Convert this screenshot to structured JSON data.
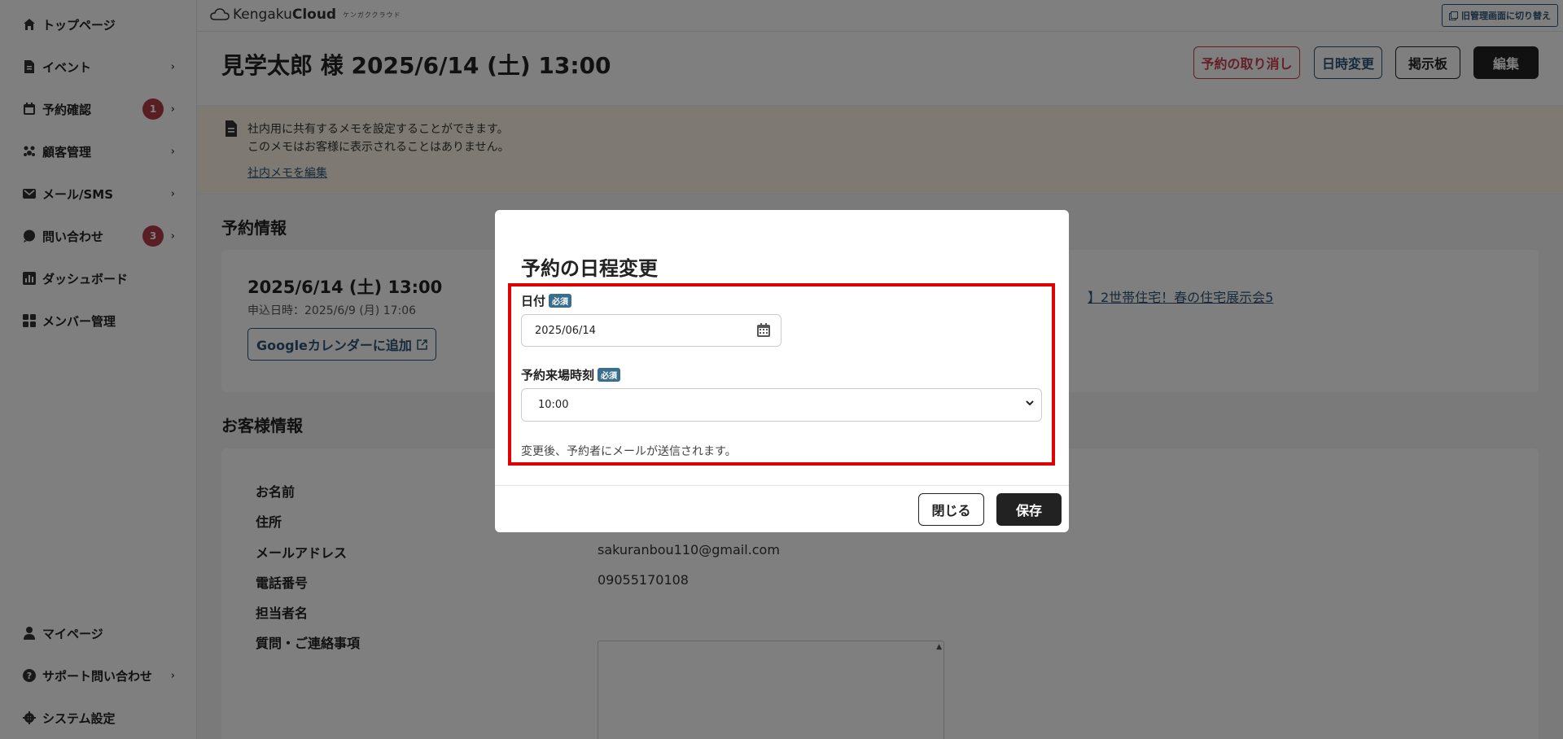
{
  "sidebar": {
    "top_items": [
      {
        "label": "トップページ",
        "icon": "home-icon",
        "chevron": ""
      },
      {
        "label": "イベント",
        "icon": "document-icon",
        "chevron": "›"
      },
      {
        "label": "予約確認",
        "icon": "calendar-icon",
        "chevron": "›",
        "badge": "1"
      },
      {
        "label": "顧客管理",
        "icon": "users-icon",
        "chevron": "›"
      },
      {
        "label": "メール/SMS",
        "icon": "mail-icon",
        "chevron": "›"
      },
      {
        "label": "問い合わせ",
        "icon": "chat-icon",
        "chevron": "›",
        "badge": "3"
      },
      {
        "label": "ダッシュボード",
        "icon": "chart-icon",
        "chevron": ""
      },
      {
        "label": "メンバー管理",
        "icon": "grid-icon",
        "chevron": ""
      }
    ],
    "bottom_items": [
      {
        "label": "マイページ",
        "icon": "user-icon",
        "chevron": ""
      },
      {
        "label": "サポート問い合わせ",
        "icon": "help-icon",
        "chevron": "›"
      },
      {
        "label": "システム設定",
        "icon": "gear-icon",
        "chevron": ""
      }
    ]
  },
  "topbar": {
    "logo_main": "Kengaku",
    "logo_bold": "Cloud",
    "logo_sub": "ケンガククラウド",
    "switch_label": "旧管理画面に切り替え"
  },
  "header": {
    "title": "見学太郎 様 2025/6/14 (土) 13:00",
    "cancel_label": "予約の取り消し",
    "reschedule_label": "日時変更",
    "board_label": "掲示板",
    "edit_label": "編集"
  },
  "memo": {
    "line1": "社内用に共有するメモを設定することができます。",
    "line2": "このメモはお客様に表示されることはありません。",
    "link": "社内メモを編集"
  },
  "reservation": {
    "section_title": "予約情報",
    "date": "2025/6/14 (土) 13:00",
    "applied": "申込日時：2025/6/9 (月) 17:06",
    "gcal_label": "Googleカレンダーに追加",
    "event_link": "】2世帯住宅！春の住宅展示会5"
  },
  "customer": {
    "section_title": "お客様情報",
    "rows": [
      {
        "label": "お名前",
        "value": ""
      },
      {
        "label": "住所",
        "value": ""
      },
      {
        "label": "メールアドレス",
        "value": "sakuranbou110@gmail.com"
      },
      {
        "label": "電話番号",
        "value": "09055170108"
      },
      {
        "label": "担当者名",
        "value": ""
      },
      {
        "label": "質問・ご連絡事項",
        "value": ""
      }
    ]
  },
  "modal": {
    "title": "予約の日程変更",
    "date_label": "日付",
    "required": "必須",
    "date_value": "2025/06/14",
    "time_label": "予約来場時刻",
    "time_value": "10:00",
    "note": "変更後、予約者にメールが送信されます。",
    "close_label": "閉じる",
    "save_label": "保存"
  }
}
